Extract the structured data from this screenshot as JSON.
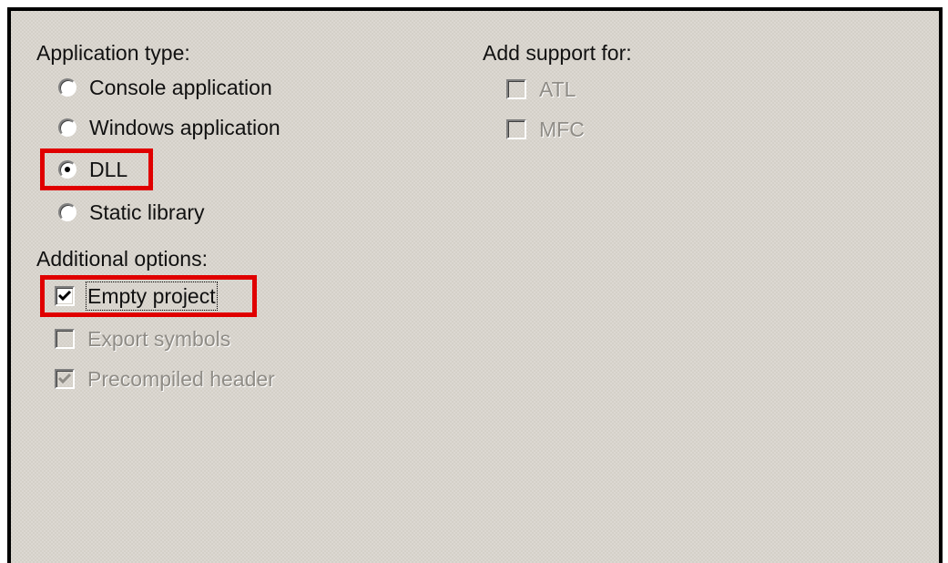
{
  "application_type": {
    "heading": "Application type:",
    "options": [
      {
        "label": "Console application",
        "selected": false
      },
      {
        "label": "Windows application",
        "selected": false
      },
      {
        "label": "DLL",
        "selected": true
      },
      {
        "label": "Static library",
        "selected": false
      }
    ]
  },
  "add_support": {
    "heading": "Add support for:",
    "options": [
      {
        "label": "ATL",
        "checked": false,
        "enabled": false
      },
      {
        "label": "MFC",
        "checked": false,
        "enabled": false
      }
    ]
  },
  "additional_options": {
    "heading": "Additional options:",
    "options": [
      {
        "label": "Empty project",
        "checked": true,
        "enabled": true
      },
      {
        "label": "Export symbols",
        "checked": false,
        "enabled": false
      },
      {
        "label": "Precompiled header",
        "checked": true,
        "enabled": false
      }
    ]
  },
  "colors": {
    "highlight": "#e00000",
    "panel_bg": "#d4d0c8",
    "disabled_text": "#8f8c86"
  }
}
